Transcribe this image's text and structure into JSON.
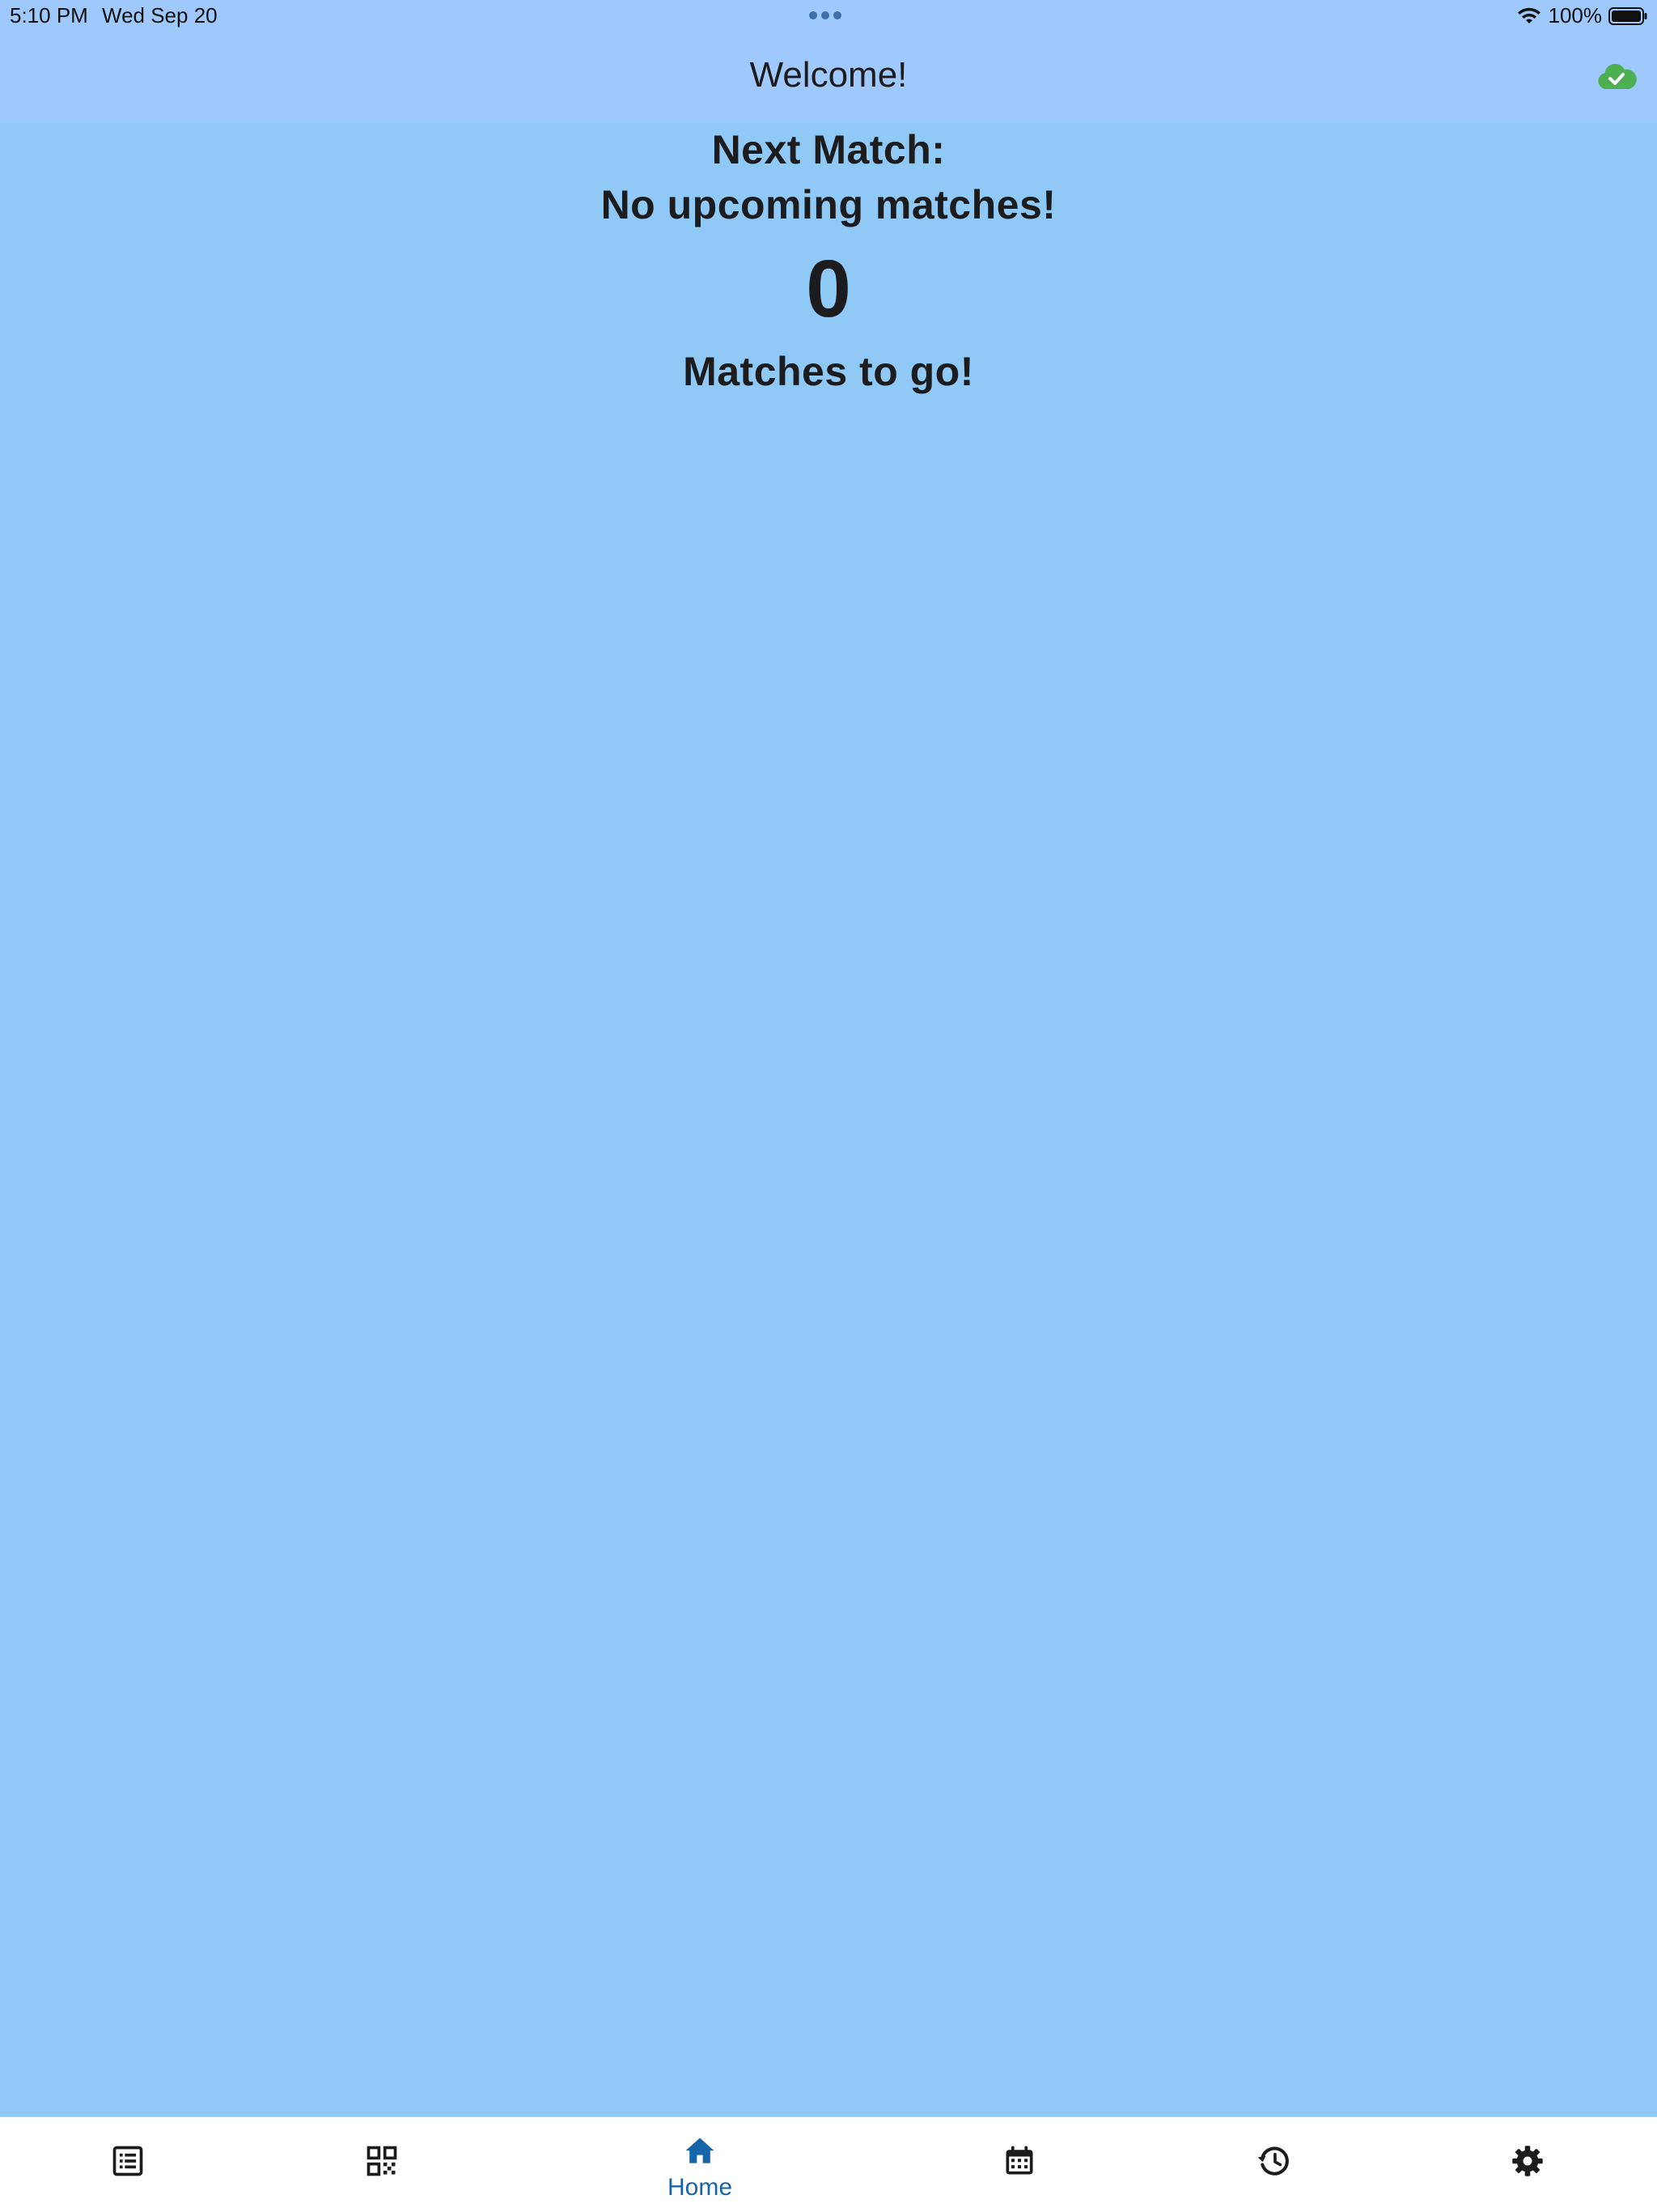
{
  "status_bar": {
    "time": "5:10 PM",
    "date": "Wed Sep 20",
    "battery": "100%"
  },
  "app_bar": {
    "title": "Welcome!",
    "sync_icon": "cloud-check-icon",
    "sync_color": "#4caf50"
  },
  "home": {
    "next_match_label": "Next Match:",
    "next_match_value": "No upcoming matches!",
    "match_count": "0",
    "matches_to_go_label": "Matches to go!"
  },
  "colors": {
    "background": "#90c8f6",
    "app_bar": "#9fc9fd",
    "nav_active": "#1565a8",
    "nav_inactive": "#1c1c1e"
  },
  "bottom_nav": {
    "items": [
      {
        "icon": "list-icon",
        "label": ""
      },
      {
        "icon": "qr-code-icon",
        "label": ""
      },
      {
        "icon": "home-icon",
        "label": "Home",
        "active": true
      },
      {
        "icon": "calendar-icon",
        "label": ""
      },
      {
        "icon": "history-icon",
        "label": ""
      },
      {
        "icon": "gear-icon",
        "label": ""
      }
    ]
  }
}
